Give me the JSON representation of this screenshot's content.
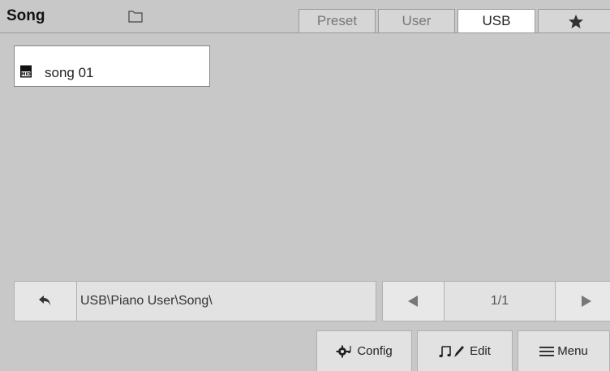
{
  "header": {
    "title": "Song",
    "tabs": [
      {
        "label": "Preset",
        "active": false
      },
      {
        "label": "User",
        "active": false
      },
      {
        "label": "USB",
        "active": true
      },
      {
        "label": "",
        "icon": "star-icon",
        "active": false
      }
    ]
  },
  "files": [
    {
      "name": "song 01",
      "icon": "mid-file-icon",
      "icon_text": "MID"
    }
  ],
  "nav": {
    "path": "USB\\Piano User\\Song\\"
  },
  "pager": {
    "page": "1/1"
  },
  "buttons": {
    "config": "Config",
    "edit": "Edit",
    "menu": "Menu"
  },
  "colors": {
    "background": "#c8c8c8",
    "active_tab": "#ffffff",
    "button_bg": "#e2e2e2"
  }
}
